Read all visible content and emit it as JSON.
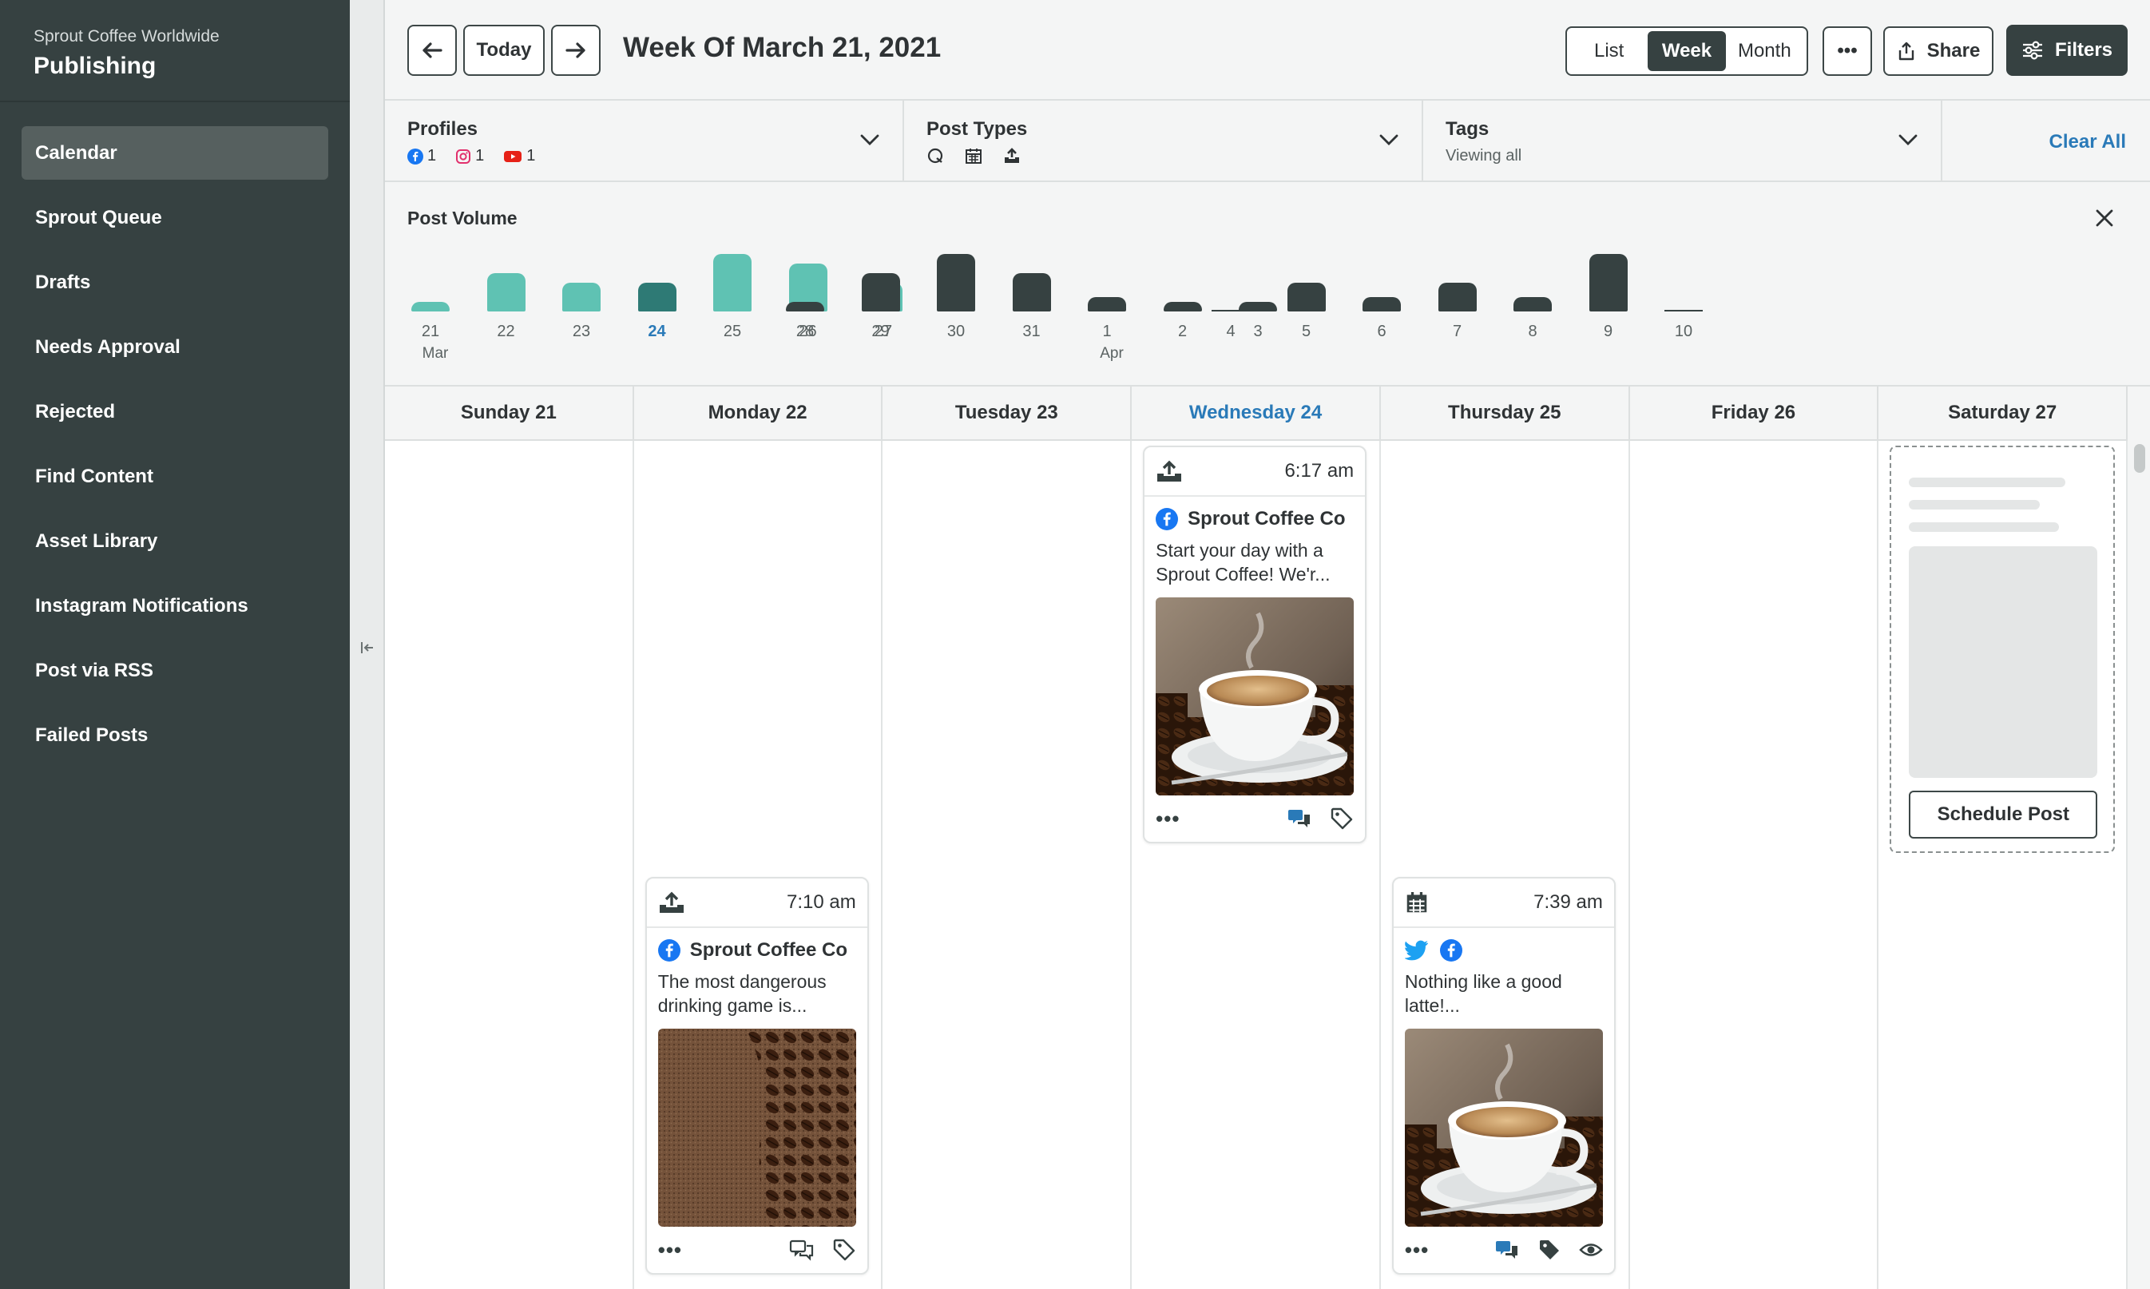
{
  "brand": {
    "org": "Sprout Coffee Worldwide",
    "app": "Publishing"
  },
  "nav": [
    {
      "label": "Calendar",
      "active": true
    },
    {
      "label": "Sprout Queue"
    },
    {
      "label": "Drafts"
    },
    {
      "label": "Needs Approval"
    },
    {
      "label": "Rejected"
    },
    {
      "label": "Find Content"
    },
    {
      "label": "Asset Library"
    },
    {
      "label": "Instagram Notifications"
    },
    {
      "label": "Post via RSS"
    },
    {
      "label": "Failed Posts"
    }
  ],
  "header": {
    "today": "Today",
    "title": "Week Of March 21, 2021",
    "views": [
      "List",
      "Week",
      "Month"
    ],
    "active_view": "Week",
    "more": "•••",
    "share": "Share",
    "filters": "Filters"
  },
  "filters": {
    "profiles": {
      "title": "Profiles",
      "facebook": "1",
      "instagram": "1",
      "youtube": "1"
    },
    "post_types": {
      "title": "Post Types"
    },
    "tags": {
      "title": "Tags",
      "sub": "Viewing all"
    },
    "clear_all": "Clear All"
  },
  "volume": {
    "title": "Post Volume"
  },
  "colors": {
    "bar_past": "#5fc2b3",
    "bar_current": "#2e7a75",
    "bar_future": "#364141",
    "accent": "#2a7ab8"
  },
  "chart_data": {
    "type": "bar",
    "title": "Post Volume",
    "categories": [
      "21",
      "22",
      "23",
      "24",
      "25",
      "26",
      "27",
      "28",
      "29",
      "30",
      "31",
      "1",
      "2",
      "3",
      "4",
      "5",
      "6",
      "7",
      "8",
      "9",
      "10"
    ],
    "category_sublabels": {
      "21": "Mar",
      "1": "Apr"
    },
    "values": [
      1,
      4,
      3,
      3,
      6,
      5,
      3,
      1,
      4,
      6,
      4,
      1.5,
      1,
      1,
      0,
      3,
      1.5,
      3,
      1.5,
      6,
      0
    ],
    "highlighted": "24"
  },
  "days": [
    "Sunday 21",
    "Monday 22",
    "Tuesday 23",
    "Wednesday 24",
    "Thursday 25",
    "Friday 26",
    "Saturday 27"
  ],
  "today_index": 3,
  "posts": {
    "wed": {
      "time": "6:17 am",
      "profile": "Sprout Coffee Co",
      "text_1": "Start your day with a",
      "text_2": "Sprout Coffee! We'r...",
      "more": "•••"
    },
    "mon": {
      "time": "7:10 am",
      "profile": "Sprout Coffee Co",
      "text_1": "The most dangerous",
      "text_2": "drinking game is...",
      "more": "•••"
    },
    "thu": {
      "time": "7:39 am",
      "text_1": "Nothing like a good",
      "text_2": "latte!...",
      "more": "•••"
    }
  },
  "schedule": {
    "button": "Schedule Post"
  }
}
